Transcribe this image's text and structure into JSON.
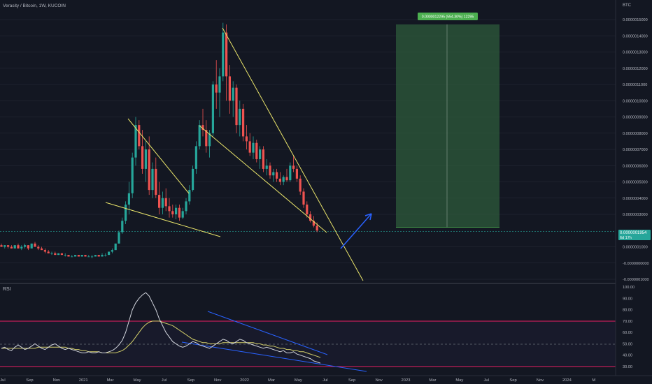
{
  "header": {
    "symbol_line": "Verasity / Bitcoin, 1W, KUCOIN"
  },
  "price_axis": {
    "currency": "BTC",
    "ticks": [
      {
        "value": 1.5e-06,
        "label": "0.0000015000"
      },
      {
        "value": 1.4e-06,
        "label": "0.0000014000"
      },
      {
        "value": 1.3e-06,
        "label": "0.0000013000"
      },
      {
        "value": 1.2e-06,
        "label": "0.0000012000"
      },
      {
        "value": 1.1e-06,
        "label": "0.0000011000"
      },
      {
        "value": 1e-06,
        "label": "0.0000010000"
      },
      {
        "value": 9e-07,
        "label": "0.0000009000"
      },
      {
        "value": 8e-07,
        "label": "0.0000008000"
      },
      {
        "value": 7e-07,
        "label": "0.0000007000"
      },
      {
        "value": 6e-07,
        "label": "0.0000006000"
      },
      {
        "value": 5e-07,
        "label": "0.0000005000"
      },
      {
        "value": 4e-07,
        "label": "0.0000004000"
      },
      {
        "value": 3e-07,
        "label": "0.0000003000"
      },
      {
        "value": 1e-07,
        "label": "0.0000001000"
      },
      {
        "value": 0.0,
        "label": "-0.0000000000"
      },
      {
        "value": -1e-07,
        "label": "-0.0000001000"
      }
    ],
    "last_price": {
      "value": 1.954e-07,
      "label": "0.0000001954",
      "countdown": "6d 17h",
      "color": "#26a69a"
    }
  },
  "rsi_panel": {
    "title": "RSI",
    "ticks": [
      {
        "value": 100,
        "label": "100.00"
      },
      {
        "value": 90,
        "label": "90.00"
      },
      {
        "value": 80,
        "label": "80.00"
      },
      {
        "value": 70,
        "label": "70.00"
      },
      {
        "value": 60,
        "label": "60.00"
      },
      {
        "value": 50,
        "label": "50.00"
      },
      {
        "value": 40,
        "label": "40.00"
      },
      {
        "value": 30,
        "label": "30.00"
      }
    ],
    "overbought": 70,
    "oversold": 30
  },
  "time_axis": {
    "labels": [
      "Jul",
      "Sep",
      "Nov",
      "2021",
      "Mar",
      "May",
      "Jul",
      "Sep",
      "Nov",
      "2022",
      "Mar",
      "May",
      "Jul",
      "Sep",
      "Nov",
      "2023",
      "Mar",
      "May",
      "Jul",
      "Sep",
      "Nov",
      "2024",
      "M"
    ]
  },
  "position_tool": {
    "label": "0.0000012295 (554.30%) 12295",
    "target_price": 1.47e-06,
    "entry_price": 2.2e-07,
    "start_date": "2022-10",
    "end_date": "2023-07",
    "fill_color": "#2e5b3b",
    "label_color": "#4caf50"
  },
  "colors": {
    "bull": "#26a69a",
    "bear": "#ef5350",
    "trendline": "#e8e36a",
    "arrow": "#2962ff",
    "rsi_line": "#d1d4dc",
    "rsi_ma": "#d4d06a",
    "band": "#e91e63",
    "grid": "#2a2e39"
  },
  "chart_data": [
    {
      "type": "candlestick",
      "title": "Verasity / Bitcoin, 1W, KUCOIN",
      "y_unit": "BTC",
      "ylim": [
        -1e-07,
        1.5e-06
      ],
      "candles": [
        {
          "o": 1.1e-07,
          "h": 1.2e-07,
          "l": 1e-07,
          "c": 1e-07
        },
        {
          "o": 1e-07,
          "h": 1.1e-07,
          "l": 9e-08,
          "c": 1.1e-07
        },
        {
          "o": 1.1e-07,
          "h": 1.1e-07,
          "l": 9e-08,
          "c": 1e-07
        },
        {
          "o": 1e-07,
          "h": 1.1e-07,
          "l": 9e-08,
          "c": 9e-08
        },
        {
          "o": 9e-08,
          "h": 1.1e-07,
          "l": 9e-08,
          "c": 1.1e-07
        },
        {
          "o": 1.1e-07,
          "h": 1.2e-07,
          "l": 9e-08,
          "c": 9e-08
        },
        {
          "o": 9e-08,
          "h": 1.1e-07,
          "l": 8e-08,
          "c": 1e-07
        },
        {
          "o": 1e-07,
          "h": 1.2e-07,
          "l": 9e-08,
          "c": 1.1e-07
        },
        {
          "o": 1.1e-07,
          "h": 1.1e-07,
          "l": 8e-08,
          "c": 9e-08
        },
        {
          "o": 9e-08,
          "h": 1.2e-07,
          "l": 9e-08,
          "c": 1.2e-07
        },
        {
          "o": 1.2e-07,
          "h": 1.3e-07,
          "l": 1e-07,
          "c": 1e-07
        },
        {
          "o": 1e-07,
          "h": 1.1e-07,
          "l": 8e-08,
          "c": 9e-08
        },
        {
          "o": 9e-08,
          "h": 1e-07,
          "l": 8e-08,
          "c": 8e-08
        },
        {
          "o": 8e-08,
          "h": 9e-08,
          "l": 6e-08,
          "c": 7e-08
        },
        {
          "o": 7e-08,
          "h": 8e-08,
          "l": 6e-08,
          "c": 6e-08
        },
        {
          "o": 6e-08,
          "h": 7e-08,
          "l": 5e-08,
          "c": 6e-08
        },
        {
          "o": 6e-08,
          "h": 7e-08,
          "l": 5e-08,
          "c": 5e-08
        },
        {
          "o": 5e-08,
          "h": 6e-08,
          "l": 5e-08,
          "c": 6e-08
        },
        {
          "o": 6e-08,
          "h": 6e-08,
          "l": 5e-08,
          "c": 5e-08
        },
        {
          "o": 5e-08,
          "h": 6e-08,
          "l": 4e-08,
          "c": 5e-08
        },
        {
          "o": 5e-08,
          "h": 5e-08,
          "l": 4e-08,
          "c": 4e-08
        },
        {
          "o": 4e-08,
          "h": 5e-08,
          "l": 4e-08,
          "c": 4e-08
        },
        {
          "o": 4e-08,
          "h": 5e-08,
          "l": 4e-08,
          "c": 5e-08
        },
        {
          "o": 5e-08,
          "h": 5e-08,
          "l": 4e-08,
          "c": 4e-08
        },
        {
          "o": 4e-08,
          "h": 5e-08,
          "l": 4e-08,
          "c": 5e-08
        },
        {
          "o": 5e-08,
          "h": 5e-08,
          "l": 4e-08,
          "c": 4e-08
        },
        {
          "o": 4e-08,
          "h": 5e-08,
          "l": 4e-08,
          "c": 4e-08
        },
        {
          "o": 4e-08,
          "h": 5e-08,
          "l": 3e-08,
          "c": 4e-08
        },
        {
          "o": 4e-08,
          "h": 5e-08,
          "l": 4e-08,
          "c": 5e-08
        },
        {
          "o": 5e-08,
          "h": 5e-08,
          "l": 4e-08,
          "c": 4e-08
        },
        {
          "o": 4e-08,
          "h": 6e-08,
          "l": 4e-08,
          "c": 5e-08
        },
        {
          "o": 5e-08,
          "h": 6e-08,
          "l": 4e-08,
          "c": 5e-08
        },
        {
          "o": 5e-08,
          "h": 7e-08,
          "l": 5e-08,
          "c": 7e-08
        },
        {
          "o": 7e-08,
          "h": 9e-08,
          "l": 6e-08,
          "c": 8e-08
        },
        {
          "o": 8e-08,
          "h": 1.2e-07,
          "l": 8e-08,
          "c": 1.2e-07
        },
        {
          "o": 1.2e-07,
          "h": 2e-07,
          "l": 1.2e-07,
          "c": 1.9e-07
        },
        {
          "o": 1.9e-07,
          "h": 2.8e-07,
          "l": 1.8e-07,
          "c": 2.6e-07
        },
        {
          "o": 2.6e-07,
          "h": 3.8e-07,
          "l": 2.4e-07,
          "c": 3.6e-07
        },
        {
          "o": 3.6e-07,
          "h": 5e-07,
          "l": 3e-07,
          "c": 4.3e-07
        },
        {
          "o": 4.3e-07,
          "h": 6.8e-07,
          "l": 4e-07,
          "c": 6.5e-07
        },
        {
          "o": 6.5e-07,
          "h": 9e-07,
          "l": 6e-07,
          "c": 8.5e-07
        },
        {
          "o": 8.5e-07,
          "h": 8.8e-07,
          "l": 7e-07,
          "c": 7.2e-07
        },
        {
          "o": 7.2e-07,
          "h": 8.2e-07,
          "l": 5.5e-07,
          "c": 5.8e-07
        },
        {
          "o": 5.8e-07,
          "h": 7.5e-07,
          "l": 5e-07,
          "c": 7e-07
        },
        {
          "o": 7e-07,
          "h": 7.8e-07,
          "l": 4.2e-07,
          "c": 4.5e-07
        },
        {
          "o": 4.5e-07,
          "h": 6.2e-07,
          "l": 4e-07,
          "c": 5.8e-07
        },
        {
          "o": 5.8e-07,
          "h": 6.5e-07,
          "l": 4e-07,
          "c": 4.2e-07
        },
        {
          "o": 4.2e-07,
          "h": 5e-07,
          "l": 3e-07,
          "c": 3.4e-07
        },
        {
          "o": 3.4e-07,
          "h": 4.4e-07,
          "l": 3e-07,
          "c": 4e-07
        },
        {
          "o": 4e-07,
          "h": 4.6e-07,
          "l": 3.2e-07,
          "c": 3.5e-07
        },
        {
          "o": 3.5e-07,
          "h": 4e-07,
          "l": 2.8e-07,
          "c": 3.2e-07
        },
        {
          "o": 3.2e-07,
          "h": 3.6e-07,
          "l": 2.8e-07,
          "c": 3e-07
        },
        {
          "o": 3e-07,
          "h": 3.6e-07,
          "l": 2.7e-07,
          "c": 3.4e-07
        },
        {
          "o": 3.4e-07,
          "h": 3.6e-07,
          "l": 2.6e-07,
          "c": 2.8e-07
        },
        {
          "o": 2.8e-07,
          "h": 3.4e-07,
          "l": 2.7e-07,
          "c": 3.2e-07
        },
        {
          "o": 3.2e-07,
          "h": 4e-07,
          "l": 3e-07,
          "c": 3.8e-07
        },
        {
          "o": 3.8e-07,
          "h": 4.8e-07,
          "l": 3.6e-07,
          "c": 4.5e-07
        },
        {
          "o": 4.5e-07,
          "h": 6e-07,
          "l": 4.4e-07,
          "c": 5.8e-07
        },
        {
          "o": 5.8e-07,
          "h": 7.5e-07,
          "l": 5.5e-07,
          "c": 7.2e-07
        },
        {
          "o": 7.2e-07,
          "h": 8.8e-07,
          "l": 7e-07,
          "c": 8.5e-07
        },
        {
          "o": 8.5e-07,
          "h": 9.5e-07,
          "l": 7.8e-07,
          "c": 8.2e-07
        },
        {
          "o": 8.2e-07,
          "h": 8.8e-07,
          "l": 6.8e-07,
          "c": 7.2e-07
        },
        {
          "o": 7.2e-07,
          "h": 8.2e-07,
          "l": 6.5e-07,
          "c": 8e-07
        },
        {
          "o": 8e-07,
          "h": 1.12e-06,
          "l": 7.8e-07,
          "c": 1.1e-06
        },
        {
          "o": 1.1e-06,
          "h": 1.25e-06,
          "l": 9.5e-07,
          "c": 1.05e-06
        },
        {
          "o": 1.05e-06,
          "h": 1.2e-06,
          "l": 9e-07,
          "c": 1.15e-06
        },
        {
          "o": 1.15e-06,
          "h": 1.48e-06,
          "l": 1.12e-06,
          "c": 1.42e-06
        },
        {
          "o": 1.42e-06,
          "h": 1.47e-06,
          "l": 1e-06,
          "c": 1.15e-06
        },
        {
          "o": 1.15e-06,
          "h": 1.22e-06,
          "l": 9.2e-07,
          "c": 1e-06
        },
        {
          "o": 1e-06,
          "h": 1.12e-06,
          "l": 9e-07,
          "c": 1.08e-06
        },
        {
          "o": 1.08e-06,
          "h": 1.1e-06,
          "l": 8e-07,
          "c": 8.5e-07
        },
        {
          "o": 8.5e-07,
          "h": 1e-06,
          "l": 7.8e-07,
          "c": 9.5e-07
        },
        {
          "o": 9.5e-07,
          "h": 9.8e-07,
          "l": 7.5e-07,
          "c": 7.8e-07
        },
        {
          "o": 7.8e-07,
          "h": 8.5e-07,
          "l": 7e-07,
          "c": 7.5e-07
        },
        {
          "o": 7.5e-07,
          "h": 8e-07,
          "l": 6.6e-07,
          "c": 6.8e-07
        },
        {
          "o": 6.8e-07,
          "h": 7.8e-07,
          "l": 6.4e-07,
          "c": 7.4e-07
        },
        {
          "o": 7.4e-07,
          "h": 7.6e-07,
          "l": 6.2e-07,
          "c": 6.4e-07
        },
        {
          "o": 6.4e-07,
          "h": 7.2e-07,
          "l": 5.8e-07,
          "c": 7e-07
        },
        {
          "o": 7e-07,
          "h": 7.2e-07,
          "l": 5.6e-07,
          "c": 5.8e-07
        },
        {
          "o": 5.8e-07,
          "h": 6.4e-07,
          "l": 5.4e-07,
          "c": 6e-07
        },
        {
          "o": 6e-07,
          "h": 6.2e-07,
          "l": 5.2e-07,
          "c": 5.4e-07
        },
        {
          "o": 5.4e-07,
          "h": 5.8e-07,
          "l": 5e-07,
          "c": 5.6e-07
        },
        {
          "o": 5.6e-07,
          "h": 5.8e-07,
          "l": 5e-07,
          "c": 5.2e-07
        },
        {
          "o": 5.2e-07,
          "h": 5.6e-07,
          "l": 4.8e-07,
          "c": 5e-07
        },
        {
          "o": 5e-07,
          "h": 5.4e-07,
          "l": 4.8e-07,
          "c": 5.3e-07
        },
        {
          "o": 5.3e-07,
          "h": 5.8e-07,
          "l": 5e-07,
          "c": 5.1e-07
        },
        {
          "o": 5.1e-07,
          "h": 6.2e-07,
          "l": 5e-07,
          "c": 6e-07
        },
        {
          "o": 6e-07,
          "h": 6.6e-07,
          "l": 5.6e-07,
          "c": 5.8e-07
        },
        {
          "o": 5.8e-07,
          "h": 6e-07,
          "l": 5e-07,
          "c": 5.2e-07
        },
        {
          "o": 5.2e-07,
          "h": 5.4e-07,
          "l": 4.2e-07,
          "c": 4.4e-07
        },
        {
          "o": 4.4e-07,
          "h": 4.6e-07,
          "l": 3.4e-07,
          "c": 3.6e-07
        },
        {
          "o": 3.6e-07,
          "h": 3.8e-07,
          "l": 2.8e-07,
          "c": 3e-07
        },
        {
          "o": 3e-07,
          "h": 3.2e-07,
          "l": 2.5e-07,
          "c": 2.6e-07
        },
        {
          "o": 2.6e-07,
          "h": 2.9e-07,
          "l": 2.2e-07,
          "c": 2.3e-07
        },
        {
          "o": 2.3e-07,
          "h": 2.5e-07,
          "l": 1.9e-07,
          "c": 2e-07
        }
      ]
    },
    {
      "type": "line",
      "title": "RSI",
      "ylim": [
        25,
        100
      ],
      "series": [
        {
          "values": [
            46,
            47,
            45,
            44,
            47,
            49,
            47,
            45,
            46,
            48,
            50,
            48,
            46,
            45,
            47,
            49,
            50,
            48,
            46,
            45,
            46,
            45,
            44,
            43,
            42,
            42,
            43,
            42,
            42,
            43,
            42,
            42,
            43,
            44,
            46,
            49,
            53,
            60,
            70,
            80,
            86,
            90,
            93,
            95,
            92,
            86,
            80,
            72,
            66,
            60,
            56,
            52,
            50,
            48,
            47,
            48,
            50,
            52,
            51,
            49,
            48,
            47,
            46,
            48,
            50,
            52,
            54,
            53,
            51,
            50,
            52,
            54,
            53,
            51,
            50,
            49,
            48,
            47,
            46,
            47,
            46,
            45,
            44,
            43,
            44,
            42,
            42,
            43,
            41,
            40,
            39,
            38,
            37,
            35,
            34,
            33
          ]
        },
        {
          "values": [
            46,
            46,
            46,
            46,
            46,
            46,
            46,
            46,
            46,
            46,
            46,
            47,
            47,
            47,
            47,
            47,
            47,
            47,
            47,
            47,
            46,
            46,
            45,
            45,
            44,
            44,
            43,
            43,
            43,
            43,
            42,
            42,
            42,
            42,
            42,
            43,
            44,
            46,
            49,
            52,
            56,
            60,
            64,
            67,
            69,
            70,
            70,
            70,
            69,
            68,
            67,
            66,
            64,
            62,
            60,
            58,
            56,
            54,
            53,
            52,
            51,
            51,
            50,
            50,
            50,
            50,
            51,
            51,
            51,
            51,
            51,
            51,
            51,
            51,
            51,
            51,
            50,
            50,
            49,
            49,
            48,
            48,
            47,
            46,
            46,
            45,
            45,
            44,
            44,
            43,
            43,
            42,
            41,
            40,
            39,
            38
          ]
        }
      ]
    }
  ]
}
